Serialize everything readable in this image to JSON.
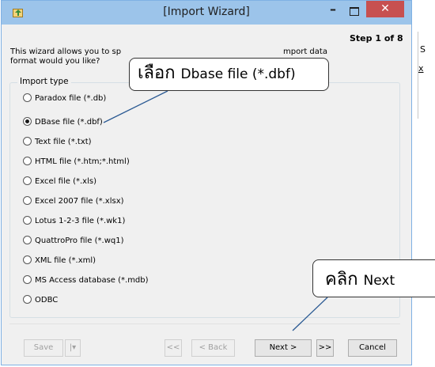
{
  "background_window": {
    "visible_chars": [
      "S",
      "x"
    ]
  },
  "window": {
    "title": "[Import Wizard]",
    "minimize_glyph": "–",
    "close_glyph": "✕",
    "step": "Step 1 of 8",
    "intro_line1": "This wizard allows you to sp",
    "intro_line2": "format would you like?",
    "intro_right": "mport data",
    "group_label": "Import type"
  },
  "import_options": [
    {
      "label": "Paradox file (*.db)",
      "checked": false
    },
    {
      "label": "DBase file (*.dbf)",
      "checked": true
    },
    {
      "label": "Text file (*.txt)",
      "checked": false
    },
    {
      "label": "HTML file (*.htm;*.html)",
      "checked": false
    },
    {
      "label": "Excel file (*.xls)",
      "checked": false
    },
    {
      "label": "Excel 2007 file (*.xlsx)",
      "checked": false
    },
    {
      "label": "Lotus 1-2-3 file (*.wk1)",
      "checked": false
    },
    {
      "label": "QuattroPro file (*.wq1)",
      "checked": false
    },
    {
      "label": "XML file (*.xml)",
      "checked": false
    },
    {
      "label": "MS Access database (*.mdb)",
      "checked": false
    },
    {
      "label": "ODBC",
      "checked": false
    }
  ],
  "buttons": {
    "save": "Save",
    "save_dropdown": "|▾",
    "first": "<<",
    "back": "< Back",
    "next": "Next >",
    "last": ">>",
    "cancel": "Cancel"
  },
  "callouts": {
    "select_thai": "เลือก",
    "select_target": "Dbase file (*.dbf)",
    "click_thai": "คลิก",
    "click_target": "Next"
  },
  "colors": {
    "titlebar": "#9cc4ea",
    "close_button": "#c75050",
    "window_bg": "#f0f0f0",
    "leader_line": "#2b5a93"
  }
}
